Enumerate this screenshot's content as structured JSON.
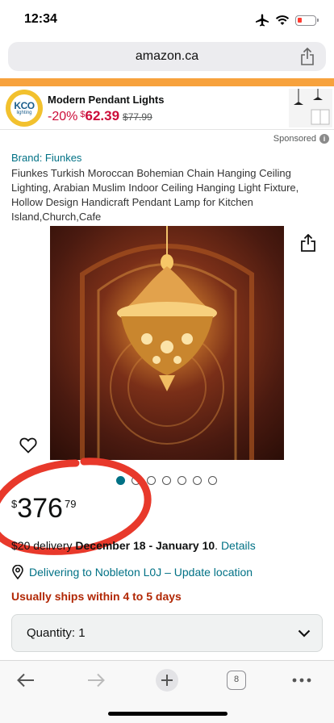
{
  "status_bar": {
    "time": "12:34"
  },
  "browser": {
    "url": "amazon.ca",
    "tab_count": "8"
  },
  "ad": {
    "logo_brand": "KCO",
    "logo_sub": "lighting",
    "title": "Modern Pendant Lights",
    "discount": "-20%",
    "currency": "$",
    "price": "62.39",
    "old_price": "$77.99",
    "sponsored_label": "Sponsored"
  },
  "product": {
    "brand_link": "Brand: Fiunkes",
    "title": "Fiunkes Turkish Moroccan Bohemian Chain Hanging Ceiling Lighting, Arabian Muslim Indoor Ceiling Hanging Light Fixture, Hollow Design Handicraft Pendant Lamp for Kitchen Island,Church,Cafe",
    "image_count": 7,
    "active_image": 1,
    "price_currency": "$",
    "price_whole": "376",
    "price_fraction": "79",
    "delivery_prefix": "$20 delivery",
    "delivery_dates": "December 18 - January 10",
    "delivery_sep": ".",
    "delivery_details": "Details",
    "location_text": "Delivering to Nobleton L0J – Update location",
    "shipping_note": "Usually ships within 4 to 5 days",
    "quantity_label": "Quantity:",
    "quantity_value": "1"
  },
  "colors": {
    "link": "#007185",
    "deal_red": "#cc0c39",
    "ships_red": "#b12704",
    "ad_stripe": "#f7a23d",
    "annotation_circle": "#e8392b"
  }
}
